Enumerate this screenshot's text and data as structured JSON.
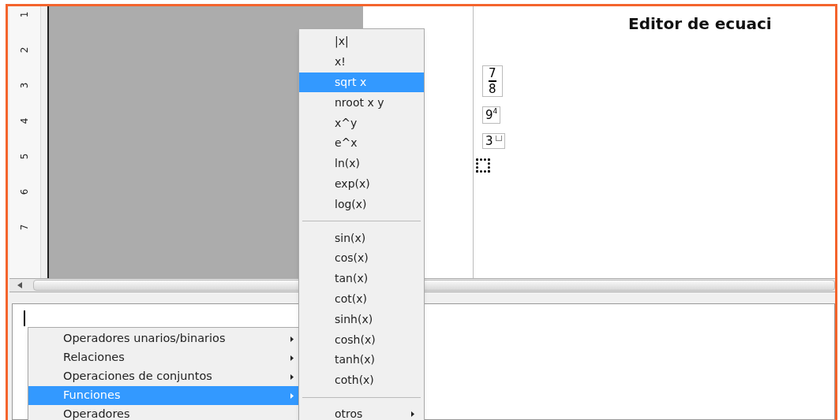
{
  "ruler": {
    "labels": [
      "1",
      "2",
      "3",
      "4",
      "5",
      "6",
      "7"
    ]
  },
  "document": {
    "heading": "Editor de ecuaci",
    "formulas": [
      {
        "kind": "fraction",
        "numerator": "7",
        "denominator": "8"
      },
      {
        "kind": "power",
        "base": "9",
        "exponent": "4"
      },
      {
        "kind": "power_placeholder",
        "base": "3"
      },
      {
        "kind": "placeholder"
      }
    ]
  },
  "context_menu": {
    "items": [
      {
        "label": "Operadores unarios/binarios",
        "selected": false,
        "has_submenu": true
      },
      {
        "label": "Relaciones",
        "selected": false,
        "has_submenu": true
      },
      {
        "label": "Operaciones de conjuntos",
        "selected": false,
        "has_submenu": true
      },
      {
        "label": "Funciones",
        "selected": true,
        "has_submenu": true
      },
      {
        "label": "Operadores",
        "selected": false,
        "has_submenu": false
      }
    ]
  },
  "submenu": {
    "items": [
      {
        "kind": "item",
        "label": "|x|",
        "selected": false,
        "has_submenu": false
      },
      {
        "kind": "item",
        "label": "x!",
        "selected": false,
        "has_submenu": false
      },
      {
        "kind": "item",
        "label": "sqrt x",
        "selected": true,
        "has_submenu": false
      },
      {
        "kind": "item",
        "label": "nroot x y",
        "selected": false,
        "has_submenu": false
      },
      {
        "kind": "item",
        "label": "x^y",
        "selected": false,
        "has_submenu": false
      },
      {
        "kind": "item",
        "label": "e^x",
        "selected": false,
        "has_submenu": false
      },
      {
        "kind": "item",
        "label": "ln(x)",
        "selected": false,
        "has_submenu": false
      },
      {
        "kind": "item",
        "label": "exp(x)",
        "selected": false,
        "has_submenu": false
      },
      {
        "kind": "item",
        "label": "log(x)",
        "selected": false,
        "has_submenu": false
      },
      {
        "kind": "separator"
      },
      {
        "kind": "item",
        "label": "sin(x)",
        "selected": false,
        "has_submenu": false
      },
      {
        "kind": "item",
        "label": "cos(x)",
        "selected": false,
        "has_submenu": false
      },
      {
        "kind": "item",
        "label": "tan(x)",
        "selected": false,
        "has_submenu": false
      },
      {
        "kind": "item",
        "label": "cot(x)",
        "selected": false,
        "has_submenu": false
      },
      {
        "kind": "item",
        "label": "sinh(x)",
        "selected": false,
        "has_submenu": false
      },
      {
        "kind": "item",
        "label": "cosh(x)",
        "selected": false,
        "has_submenu": false
      },
      {
        "kind": "item",
        "label": "tanh(x)",
        "selected": false,
        "has_submenu": false
      },
      {
        "kind": "item",
        "label": "coth(x)",
        "selected": false,
        "has_submenu": false
      },
      {
        "kind": "separator"
      },
      {
        "kind": "item",
        "label": "otros",
        "selected": false,
        "has_submenu": true
      }
    ]
  }
}
